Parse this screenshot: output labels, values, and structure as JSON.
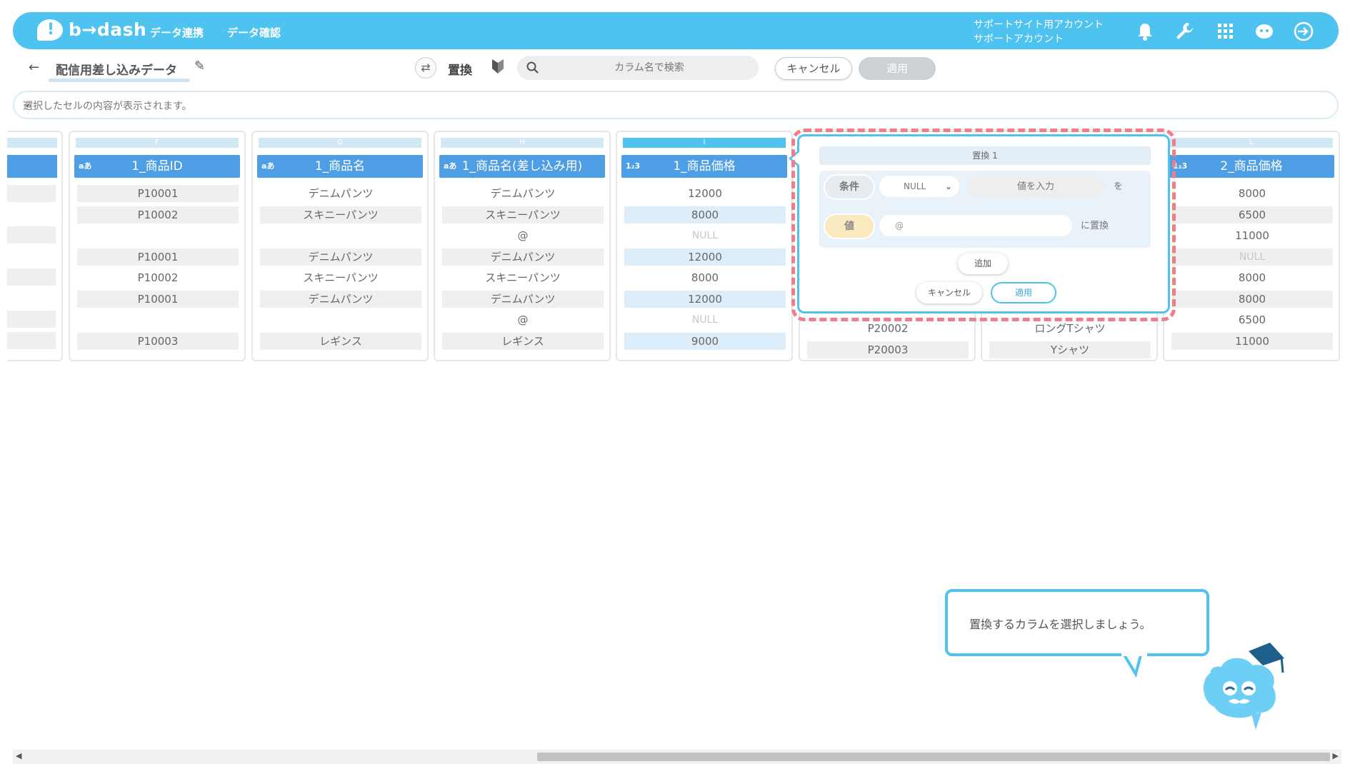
{
  "header": {
    "logo_text": "b→dash",
    "nav": [
      "データ連携",
      "データ確認"
    ],
    "account_line1": "サポートサイト用アカウント",
    "account_line2": "サポートアカウント"
  },
  "toolbar": {
    "back": "←",
    "title": "配信用差し込みデータ",
    "mode_label": "置換",
    "search_placeholder": "カラム名で検索",
    "cancel_label": "キャンセル",
    "apply_label": "適用"
  },
  "cellbar": {
    "placeholder": "選択したセルの内容が表示されます。"
  },
  "columns": [
    {
      "letter": "F",
      "type": "aあ",
      "name": "1_商品ID",
      "cells": [
        "P10001",
        "P10002",
        "",
        "P10001",
        "P10002",
        "P10001",
        "",
        "P10003"
      ]
    },
    {
      "letter": "G",
      "type": "aあ",
      "name": "1_商品名",
      "cells": [
        "デニムパンツ",
        "スキニーパンツ",
        "",
        "デニムパンツ",
        "スキニーパンツ",
        "デニムパンツ",
        "",
        "レギンス"
      ]
    },
    {
      "letter": "H",
      "type": "aあ",
      "name": "1_商品名(差し込み用)",
      "cells": [
        "デニムパンツ",
        "スキニーパンツ",
        "@",
        "デニムパンツ",
        "スキニーパンツ",
        "デニムパンツ",
        "@",
        "レギンス"
      ]
    },
    {
      "letter": "I",
      "type": "1₂3",
      "name": "1_商品価格",
      "cells": [
        "12000",
        "8000",
        "NULL",
        "12000",
        "8000",
        "12000",
        "NULL",
        "9000"
      ]
    },
    {
      "letter": "J",
      "type": "",
      "name": "",
      "cells": [
        "",
        "",
        "",
        "",
        "",
        "",
        "P20002",
        "P20003"
      ]
    },
    {
      "letter": "K",
      "type": "",
      "name": "",
      "cells": [
        "",
        "",
        "",
        "",
        "",
        "",
        "ロングTシャツ",
        "Yシャツ"
      ]
    },
    {
      "letter": "L",
      "type": "1₂3",
      "name": "2_商品価格",
      "cells": [
        "8000",
        "6500",
        "11000",
        "NULL",
        "8000",
        "8000",
        "6500",
        "11000"
      ]
    }
  ],
  "replace_popup": {
    "rule_title": "置換 1",
    "condition_label": "条件",
    "condition_value": "NULL",
    "value_placeholder": "値を入力",
    "wo": "を",
    "value_label": "値",
    "replace_value": "@",
    "ni_okikae": "に置換",
    "add_label": "追加",
    "cancel_label": "キャンセル",
    "apply_label": "適用"
  },
  "tooltip": {
    "text": "置換するカラムを選択しましょう。"
  },
  "colors": {
    "brand": "#4ec3ef",
    "column_header": "#4d9ee4",
    "highlight": "#f07d8c"
  }
}
